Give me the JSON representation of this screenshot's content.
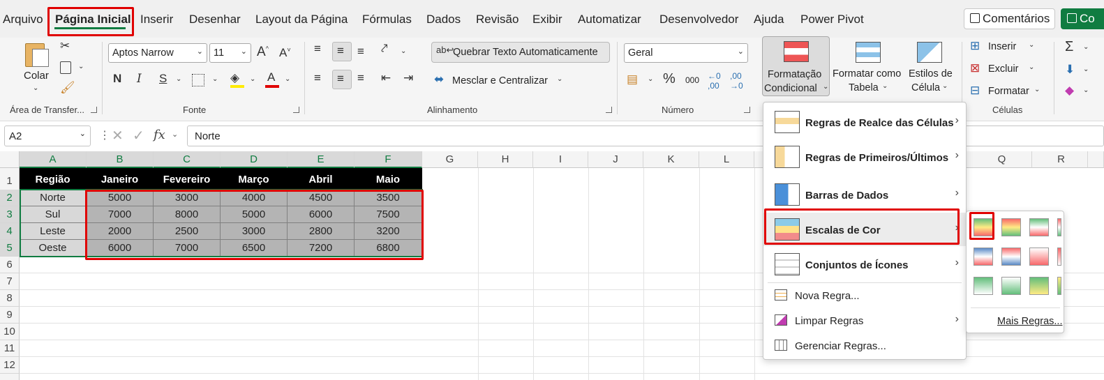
{
  "tabs": [
    "Arquivo",
    "Página Inicial",
    "Inserir",
    "Desenhar",
    "Layout da Página",
    "Fórmulas",
    "Dados",
    "Revisão",
    "Exibir",
    "Automatizar",
    "Desenvolvedor",
    "Ajuda",
    "Power Pivot"
  ],
  "active_tab": "Página Inicial",
  "top_buttons": {
    "comments": "Comentários",
    "share": "Co"
  },
  "ribbon": {
    "clipboard": {
      "paste": "Colar",
      "label": "Área de Transfer..."
    },
    "font": {
      "name": "Aptos Narrow",
      "size": "11",
      "bold": "N",
      "italic": "I",
      "underline": "S",
      "label": "Fonte"
    },
    "alignment": {
      "wrap": "Quebrar Texto Automaticamente",
      "merge": "Mesclar e Centralizar",
      "label": "Alinhamento"
    },
    "number": {
      "format": "Geral",
      "label": "Número",
      "percent": "%",
      "thousands": "000"
    },
    "styles": {
      "conditional_line1": "Formatação",
      "conditional_line2": "Condicional",
      "table_line1": "Formatar como",
      "table_line2": "Tabela",
      "cell_line1": "Estilos de",
      "cell_line2": "Célula"
    },
    "cells": {
      "insert": "Inserir",
      "delete": "Excluir",
      "format": "Formatar",
      "label": "Células"
    }
  },
  "formula_bar": {
    "name_box": "A2",
    "fx": "fx",
    "content": "Norte"
  },
  "columns": [
    "A",
    "B",
    "C",
    "D",
    "E",
    "F",
    "G",
    "H",
    "I",
    "J",
    "K",
    "L",
    "Q",
    "R"
  ],
  "rows": [
    "1",
    "2",
    "3",
    "4",
    "5",
    "6",
    "7",
    "8",
    "9",
    "10",
    "11",
    "12"
  ],
  "table": {
    "headers": [
      "Região",
      "Janeiro",
      "Fevereiro",
      "Março",
      "Abril",
      "Maio"
    ],
    "rows": [
      [
        "Norte",
        "5000",
        "3000",
        "4000",
        "4500",
        "3500"
      ],
      [
        "Sul",
        "7000",
        "8000",
        "5000",
        "6000",
        "7500"
      ],
      [
        "Leste",
        "2000",
        "2500",
        "3000",
        "2800",
        "3200"
      ],
      [
        "Oeste",
        "6000",
        "7000",
        "6500",
        "7200",
        "6800"
      ]
    ]
  },
  "menu": {
    "items": [
      "Regras de Realce das Células",
      "Regras de Primeiros/Últimos",
      "Barras de Dados",
      "Escalas de Cor",
      "Conjuntos de Ícones"
    ],
    "small_items": [
      "Nova Regra...",
      "Limpar Regras",
      "Gerenciar Regras..."
    ]
  },
  "submenu": {
    "more": "Mais Regras..."
  },
  "colors": {
    "accent": "#107c41",
    "highlight": "#e00000"
  }
}
